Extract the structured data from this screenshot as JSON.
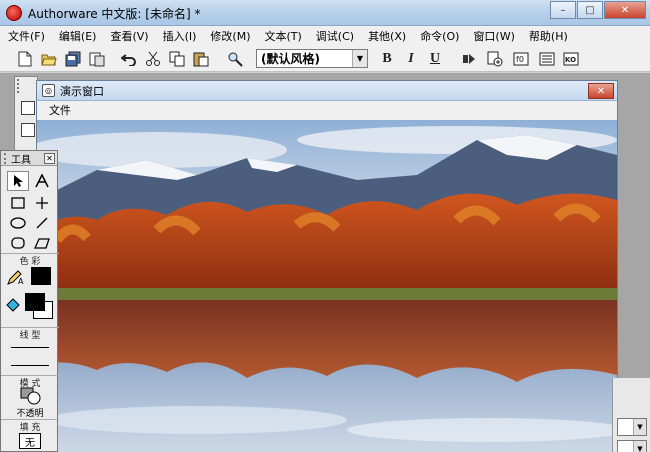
{
  "window": {
    "title": "Authorware 中文版: [未命名] *",
    "buttons": {
      "minimize": "–",
      "maximize": "□",
      "close": "✕"
    }
  },
  "menubar": {
    "items": [
      "文件(F)",
      "编辑(E)",
      "查看(V)",
      "插入(I)",
      "修改(M)",
      "文本(T)",
      "调试(C)",
      "其他(X)",
      "命令(O)",
      "窗口(W)",
      "帮助(H)"
    ]
  },
  "toolbar": {
    "style_select": {
      "value": "(默认风格)"
    },
    "bold": "B",
    "italic": "I",
    "underline": "U",
    "icons": [
      "new-icon",
      "open-icon",
      "save-all-icon",
      "import-icon",
      "undo-icon",
      "cut-icon",
      "copy-icon",
      "paste-icon",
      "find-icon",
      "run-icon",
      "control-panel-icon",
      "functions-icon",
      "variables-icon",
      "knowledge-objects-icon"
    ]
  },
  "presentation_window": {
    "title": "演示窗口",
    "menu": [
      "文件"
    ],
    "close": "✕",
    "scene": "autumn-lake-mountains"
  },
  "tools_palette": {
    "title": "工具",
    "close": "✕",
    "tools": [
      "pointer-tool-icon",
      "text-tool-icon",
      "rectangle-tool-icon",
      "straight-line-tool-icon",
      "ellipse-tool-icon",
      "diagonal-line-tool-icon",
      "rounded-rectangle-tool-icon",
      "polygon-tool-icon"
    ],
    "color_label": "色 彩",
    "line_label": "线 型",
    "mode_label": "模 式",
    "mode_value": "不透明",
    "fill_label": "填 充",
    "fill_value": "无",
    "colors": {
      "stroke": "#000000",
      "fill_foreground": "#000000",
      "fill_background": "#ffffff"
    }
  }
}
